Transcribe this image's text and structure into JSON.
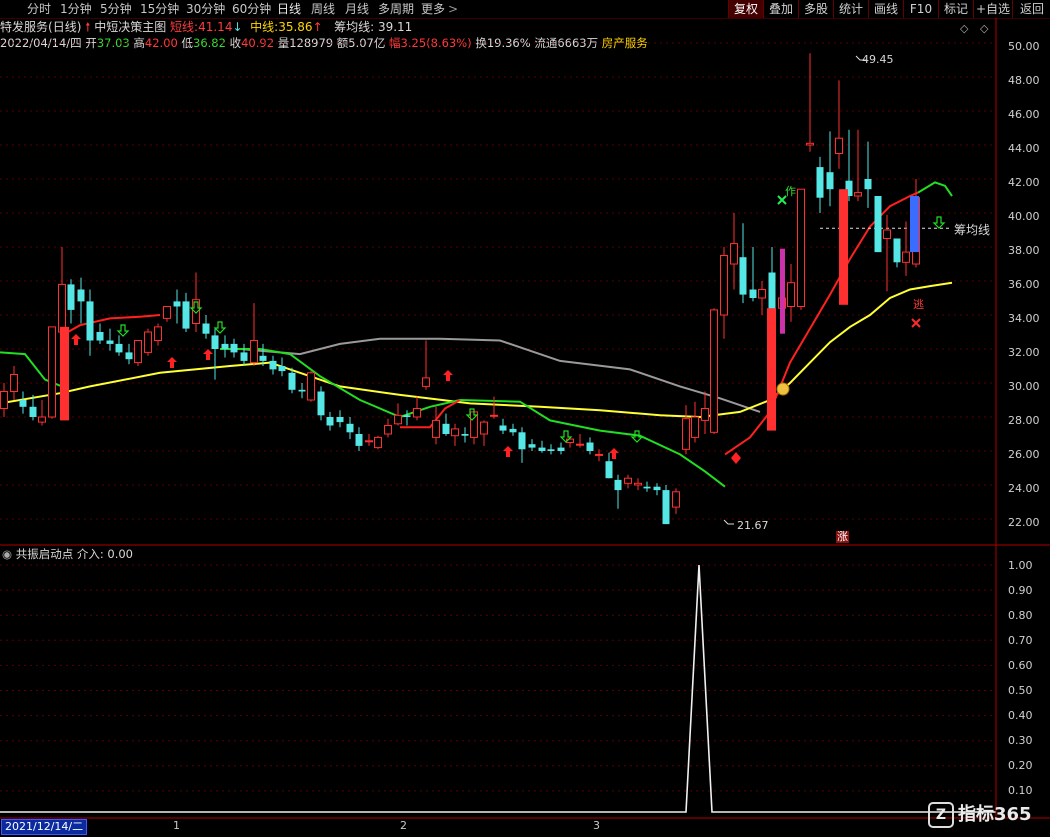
{
  "period_tabs": [
    "分时",
    "1分钟",
    "5分钟",
    "15分钟",
    "30分钟",
    "60分钟",
    "日线",
    "周线",
    "月线",
    "多周期",
    "更多"
  ],
  "right_buttons": [
    "复权",
    "叠加",
    "多股",
    "统计",
    "画线",
    "F10",
    "标记",
    "+自选",
    "返回"
  ],
  "header": {
    "stock_name": "特发服务",
    "period": "(日线)",
    "formula": "中短决策主图",
    "short_label": "短线:",
    "short_value": "41.14",
    "mid_label": "中线:",
    "mid_value": "35.86",
    "chip_label": "筹均线:",
    "chip_value": "39.11"
  },
  "quote": {
    "date": "2022/04/14/四",
    "open_label": "开",
    "open": "37.03",
    "high_label": "高",
    "high": "42.00",
    "low_label": "低",
    "low": "36.82",
    "close_label": "收",
    "close": "40.92",
    "vol_label": "量",
    "vol": "128979",
    "amt_label": "额",
    "amt": "5.07亿",
    "chg_label": "幅",
    "chg": "3.25(8.63%)",
    "turn_label": "换",
    "turn": "19.36%",
    "float_label": "流通",
    "float": "6663万",
    "sector": "房产服务"
  },
  "price_axis": [
    "50.00",
    "48.00",
    "46.00",
    "44.00",
    "42.00",
    "40.00",
    "38.00",
    "36.00",
    "34.00",
    "32.00",
    "30.00",
    "28.00",
    "26.00",
    "24.00",
    "22.00"
  ],
  "ind_axis": [
    "1.00",
    "0.90",
    "0.80",
    "0.70",
    "0.60",
    "0.50",
    "0.40",
    "0.30",
    "0.20",
    "0.10"
  ],
  "annotations": {
    "high": "49.45",
    "low": "21.67",
    "chip_line": "筹均线",
    "zuo": "作",
    "tao": "逃",
    "zhang": "涨"
  },
  "indicator": {
    "name": "共振启动点",
    "value_label": "介入:",
    "value": "0.00"
  },
  "time_axis": {
    "cursor": "2021/12/14/二",
    "months": [
      "1",
      "2",
      "3"
    ]
  },
  "watermark": "指标365",
  "colors": {
    "up": "#ff3030",
    "down": "#55e6e6",
    "short": "#ff2020",
    "mid": "#ffff33",
    "chip": "#9a9a9a",
    "green": "#22dd22"
  },
  "chart_data": {
    "type": "candlestick",
    "close_last": 40.92,
    "high_marker": 49.45,
    "low_marker": 21.67,
    "candles": [
      [
        28.5,
        30.0,
        28.0,
        29.5
      ],
      [
        29.5,
        31.0,
        29.0,
        30.5
      ],
      [
        29.0,
        29.5,
        28.2,
        28.6
      ],
      [
        28.6,
        29.3,
        27.8,
        28.0
      ],
      [
        27.7,
        29.0,
        27.5,
        28.0
      ],
      [
        28.0,
        33.3,
        27.9,
        33.3
      ],
      [
        33.0,
        38.0,
        32.7,
        35.8
      ],
      [
        35.8,
        36.1,
        33.5,
        34.3
      ],
      [
        35.5,
        36.2,
        33.5,
        34.8
      ],
      [
        34.8,
        35.5,
        31.6,
        32.5
      ],
      [
        33.0,
        33.5,
        32.3,
        32.5
      ],
      [
        32.5,
        33.2,
        31.9,
        32.3
      ],
      [
        32.3,
        32.8,
        31.6,
        31.8
      ],
      [
        31.8,
        32.3,
        31.1,
        31.4
      ],
      [
        31.2,
        32.5,
        31.0,
        32.5
      ],
      [
        31.8,
        33.2,
        31.6,
        33.0
      ],
      [
        32.5,
        33.5,
        32.2,
        33.3
      ],
      [
        33.8,
        34.5,
        33.6,
        34.5
      ],
      [
        34.8,
        35.5,
        33.5,
        34.5
      ],
      [
        34.8,
        35.3,
        33.0,
        33.2
      ],
      [
        33.5,
        36.5,
        33.0,
        34.9
      ],
      [
        33.5,
        34.0,
        32.6,
        32.9
      ],
      [
        32.8,
        33.2,
        30.2,
        32.0
      ],
      [
        32.3,
        32.8,
        31.5,
        32.0
      ],
      [
        32.3,
        32.6,
        31.5,
        31.8
      ],
      [
        31.8,
        32.3,
        31.0,
        31.3
      ],
      [
        31.2,
        34.7,
        31.0,
        32.5
      ],
      [
        31.6,
        32.3,
        31.0,
        31.3
      ],
      [
        31.3,
        31.6,
        30.5,
        30.8
      ],
      [
        31.0,
        31.5,
        30.4,
        30.7
      ],
      [
        30.6,
        30.9,
        29.4,
        29.6
      ],
      [
        29.6,
        30.0,
        29.1,
        29.5
      ],
      [
        29.0,
        30.7,
        28.9,
        30.6
      ],
      [
        29.5,
        29.8,
        27.8,
        28.1
      ],
      [
        28.0,
        28.3,
        27.2,
        27.5
      ],
      [
        28.0,
        28.4,
        27.4,
        27.7
      ],
      [
        27.6,
        28.0,
        26.7,
        27.1
      ],
      [
        27.0,
        27.4,
        26.0,
        26.3
      ],
      [
        26.6,
        27.0,
        26.3,
        26.6
      ],
      [
        26.2,
        26.9,
        26.1,
        26.8
      ],
      [
        27.0,
        27.9,
        26.8,
        27.5
      ],
      [
        27.6,
        28.8,
        27.5,
        28.1
      ],
      [
        28.1,
        28.4,
        27.5,
        28.0
      ],
      [
        28.0,
        29.2,
        27.8,
        28.5
      ],
      [
        29.8,
        32.5,
        29.6,
        30.3
      ],
      [
        26.8,
        28.6,
        26.4,
        27.8
      ],
      [
        27.6,
        28.2,
        26.9,
        27.0
      ],
      [
        26.9,
        27.6,
        26.3,
        27.3
      ],
      [
        27.0,
        27.4,
        26.5,
        26.9
      ],
      [
        26.8,
        28.5,
        26.4,
        28.3
      ],
      [
        27.0,
        27.8,
        26.3,
        27.7
      ],
      [
        28.1,
        29.2,
        27.9,
        28.1
      ],
      [
        27.5,
        27.9,
        27.0,
        27.2
      ],
      [
        27.3,
        27.6,
        26.9,
        27.1
      ],
      [
        27.1,
        27.4,
        25.3,
        26.1
      ],
      [
        26.4,
        26.7,
        26.0,
        26.2
      ],
      [
        26.2,
        26.6,
        25.9,
        26.0
      ],
      [
        26.1,
        26.4,
        25.8,
        26.0
      ],
      [
        26.2,
        26.5,
        25.8,
        26.0
      ],
      [
        26.5,
        26.8,
        26.2,
        26.7
      ],
      [
        26.4,
        27.0,
        26.2,
        26.4
      ],
      [
        26.5,
        26.8,
        25.8,
        26.0
      ],
      [
        25.8,
        26.1,
        25.4,
        25.8
      ],
      [
        25.4,
        25.9,
        24.4,
        24.4
      ],
      [
        24.3,
        24.6,
        22.6,
        23.7
      ],
      [
        24.1,
        24.6,
        23.8,
        24.4
      ],
      [
        24.0,
        24.4,
        23.7,
        24.1
      ],
      [
        23.9,
        24.2,
        23.6,
        23.8
      ],
      [
        23.9,
        24.1,
        23.4,
        23.7
      ],
      [
        23.7,
        24.0,
        21.7,
        21.7
      ],
      [
        22.7,
        23.8,
        22.3,
        23.6
      ],
      [
        26.1,
        28.7,
        25.8,
        27.9
      ],
      [
        26.8,
        28.9,
        26.5,
        28.0
      ],
      [
        27.8,
        29.5,
        27.0,
        28.5
      ],
      [
        27.1,
        34.4,
        27.0,
        34.3
      ],
      [
        34.0,
        38.0,
        32.6,
        37.5
      ],
      [
        37.0,
        40.0,
        35.5,
        38.2
      ],
      [
        37.4,
        39.4,
        34.7,
        35.2
      ],
      [
        35.5,
        38.0,
        34.8,
        35.0
      ],
      [
        35.0,
        36.0,
        34.0,
        35.5
      ],
      [
        36.5,
        38.0,
        33.6,
        34.0
      ],
      [
        34.4,
        35.4,
        34.0,
        35.0
      ],
      [
        34.5,
        37.0,
        33.6,
        35.9
      ],
      [
        34.5,
        41.4,
        34.3,
        41.4
      ],
      [
        44.0,
        49.4,
        43.6,
        44.1
      ],
      [
        42.7,
        43.3,
        40.0,
        40.9
      ],
      [
        42.4,
        44.8,
        40.4,
        41.4
      ],
      [
        43.5,
        47.8,
        42.6,
        44.4
      ],
      [
        41.9,
        44.9,
        40.7,
        41.0
      ],
      [
        41.0,
        44.9,
        40.7,
        41.2
      ],
      [
        42.0,
        44.2,
        40.3,
        41.4
      ],
      [
        41.0,
        41.0,
        37.7,
        37.7
      ],
      [
        38.5,
        39.9,
        35.4,
        39.0
      ],
      [
        38.5,
        38.5,
        36.8,
        37.1
      ],
      [
        37.1,
        39.5,
        36.3,
        37.7
      ],
      [
        37.0,
        42.0,
        36.8,
        40.9
      ]
    ]
  }
}
